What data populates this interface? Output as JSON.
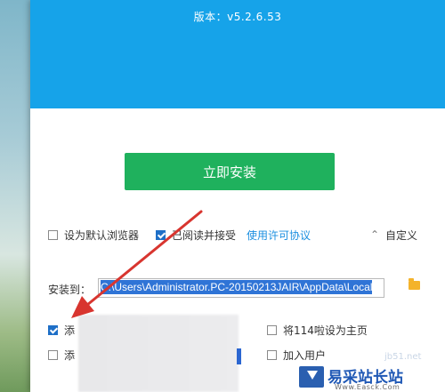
{
  "header": {
    "version_text": "版本：v5.2.6.53"
  },
  "main": {
    "install_button_label": "立即安装"
  },
  "options": {
    "default_browser": {
      "label": "设为默认浏览器",
      "checked": false
    },
    "agree": {
      "label": "已阅读并接受",
      "link": "使用许可协议",
      "checked": true
    },
    "customize_label": "自定义",
    "install_path_label": "安装到：",
    "install_path_value": "C:\\Users\\Administrator.PC-20150213JAIR\\AppData\\Local",
    "add_shortcut_partial": "添",
    "add_other_partial": "添",
    "set_homepage_label": "将114啦设为主页",
    "join_user_program_label": "加入用户",
    "set_homepage_checked": false,
    "join_program_checked": false
  },
  "watermark": {
    "title": "易采站长站",
    "url": "Www.Easck.Com",
    "faint_url": "jb51.net"
  },
  "colors": {
    "header_blue": "#16a3e9",
    "install_green": "#1fb15d",
    "link_blue": "#1b8fe0",
    "arrow_red": "#d8352f"
  },
  "icons": {
    "folder": "folder-icon",
    "customize": "chevron-up-icon"
  }
}
